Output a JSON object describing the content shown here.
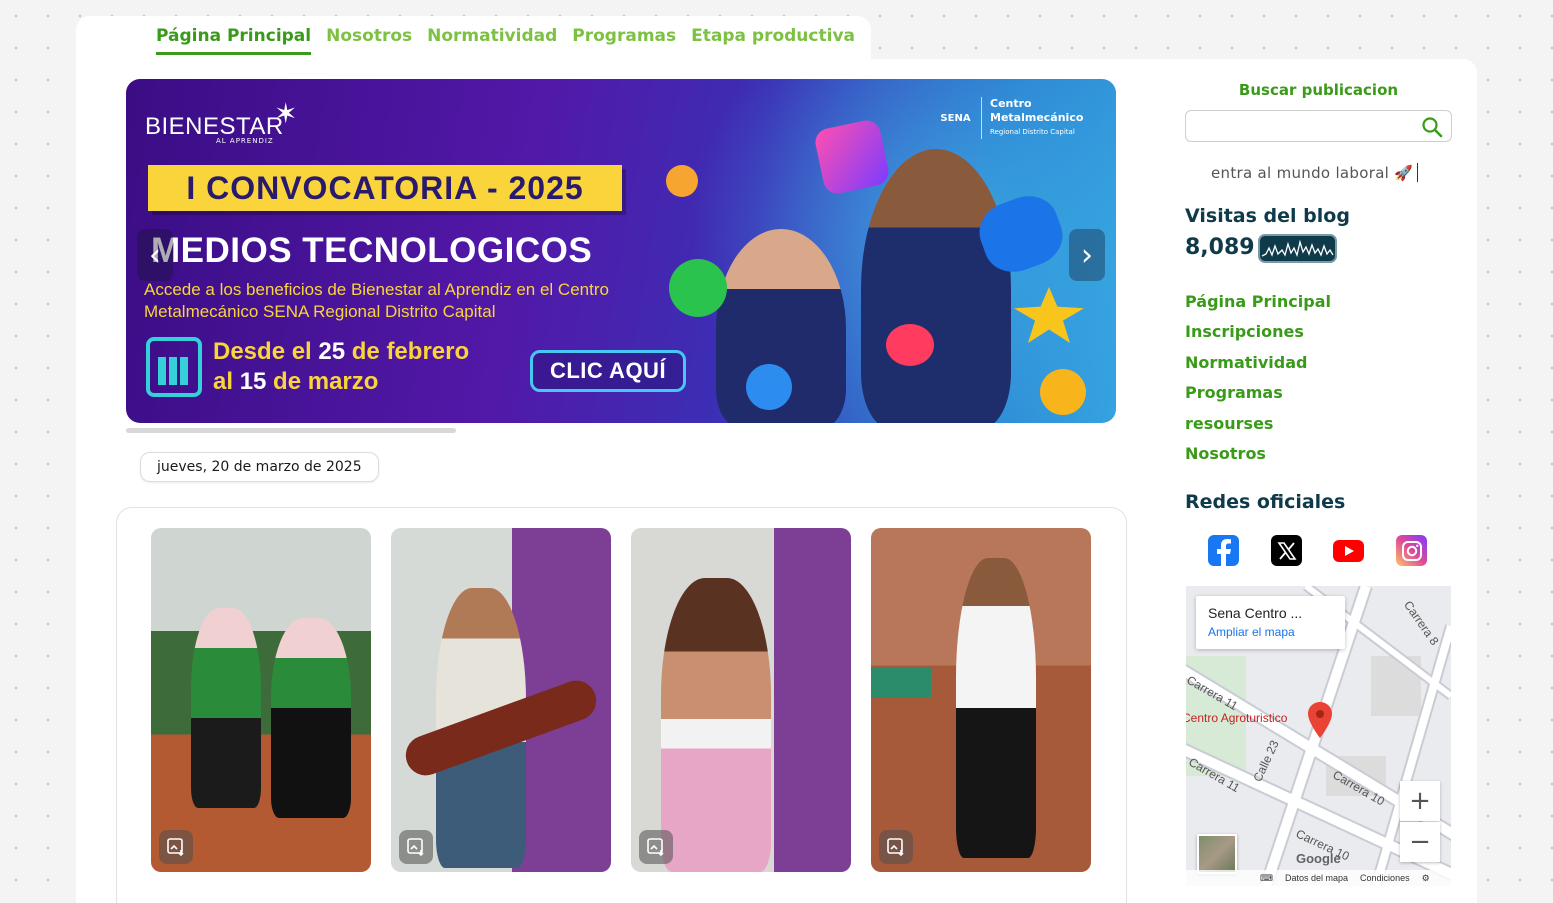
{
  "topnav": {
    "items": [
      "Página Principal",
      "Nosotros",
      "Normatividad",
      "Programas",
      "Etapa productiva"
    ]
  },
  "banner": {
    "brand": "BIENESTAR",
    "brand_sub": "AL APRENDIZ",
    "org_line1": "Centro",
    "org_line2": "Metalmecánico",
    "org_line3": "Regional Distrito Capital",
    "sena": "SENA",
    "convocatoria": "I CONVOCATORIA - 2025",
    "headline": "MEDIOS TECNOLOGICOS",
    "body": "Accede a los beneficios de Bienestar al Aprendiz en el Centro Metalmecánico SENA Regional Distrito Capital",
    "dates_prefix": "Desde el ",
    "dates_day1": "25",
    "dates_mid": " de febrero",
    "dates_al": "al ",
    "dates_day2": "15",
    "dates_end": " de marzo",
    "cta": "CLIC AQUÍ",
    "prev_icon": "‹",
    "next_icon": "›"
  },
  "date_badge": "jueves, 20 de marzo de 2025",
  "sidebar": {
    "search_title": "Buscar publicacion",
    "search_value": "",
    "tagline": "entra al mundo laboral 🚀",
    "visits_title": "Visitas del blog",
    "visits_count": "8,089",
    "nav": [
      "Página Principal",
      "Inscripciones",
      "Normatividad",
      "Programas",
      "resourses",
      "Nosotros"
    ],
    "social_title": "Redes oficiales",
    "social": [
      "facebook-icon",
      "x-icon",
      "youtube-icon",
      "instagram-icon"
    ]
  },
  "map": {
    "place": "Sena Centro ...",
    "enlarge": "Ampliar el mapa",
    "marker_label": "Centro Agroturistico",
    "roads": [
      "Carrera 8",
      "Carrera 10",
      "Carrera 11",
      "Calle 23",
      "Carrera 10",
      "Carrera 11"
    ],
    "footer_data": "Datos del mapa",
    "footer_terms": "Condiciones",
    "google": "Google"
  },
  "colors": {
    "green": "#3a9a1a",
    "light_green": "#7dc142",
    "navy": "#0f3a4a"
  }
}
